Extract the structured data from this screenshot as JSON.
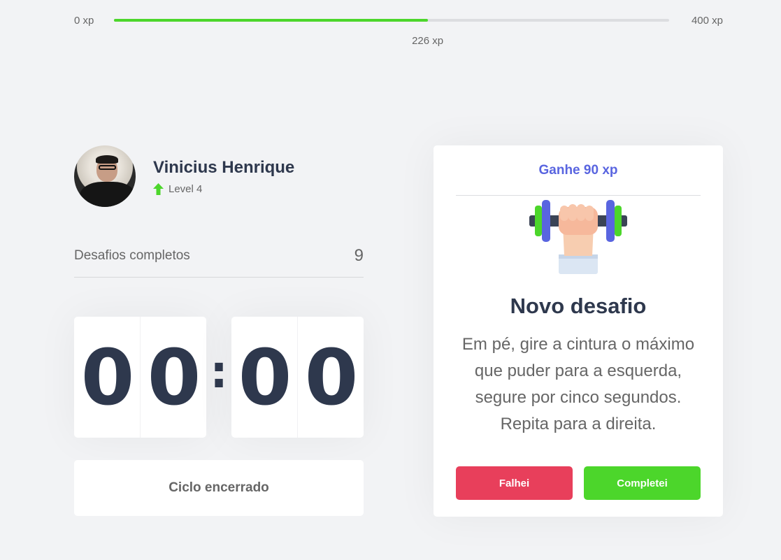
{
  "experience_bar": {
    "min_label": "0 xp",
    "max_label": "400 xp",
    "current_label": "226 xp",
    "current_xp": 226,
    "max_xp": 400,
    "fill_color": "#4cd62b"
  },
  "profile": {
    "name": "Vinicius Henrique",
    "level_label": "Level 4",
    "level_icon": "arrow-up-icon",
    "avatar": "user-photo"
  },
  "completed_challenges": {
    "label": "Desafios completos",
    "count": "9"
  },
  "countdown": {
    "minute_left": "0",
    "minute_right": "0",
    "separator": ":",
    "second_left": "0",
    "second_right": "0"
  },
  "cycle_button": {
    "label": "Ciclo encerrado"
  },
  "challenge_card": {
    "reward_label": "Ganhe 90 xp",
    "icon": "dumbbell-body-icon",
    "title": "Novo desafio",
    "description": "Em pé, gire a cintura o máximo que puder para a esquerda, segure por cinco segundos. Repita para a direita.",
    "fail_label": "Falhei",
    "success_label": "Completei"
  },
  "colors": {
    "background": "#f2f3f5",
    "title": "#2e384d",
    "text": "#666666",
    "blue": "#5965e0",
    "red": "#e83f5b",
    "green": "#4cd62b"
  }
}
